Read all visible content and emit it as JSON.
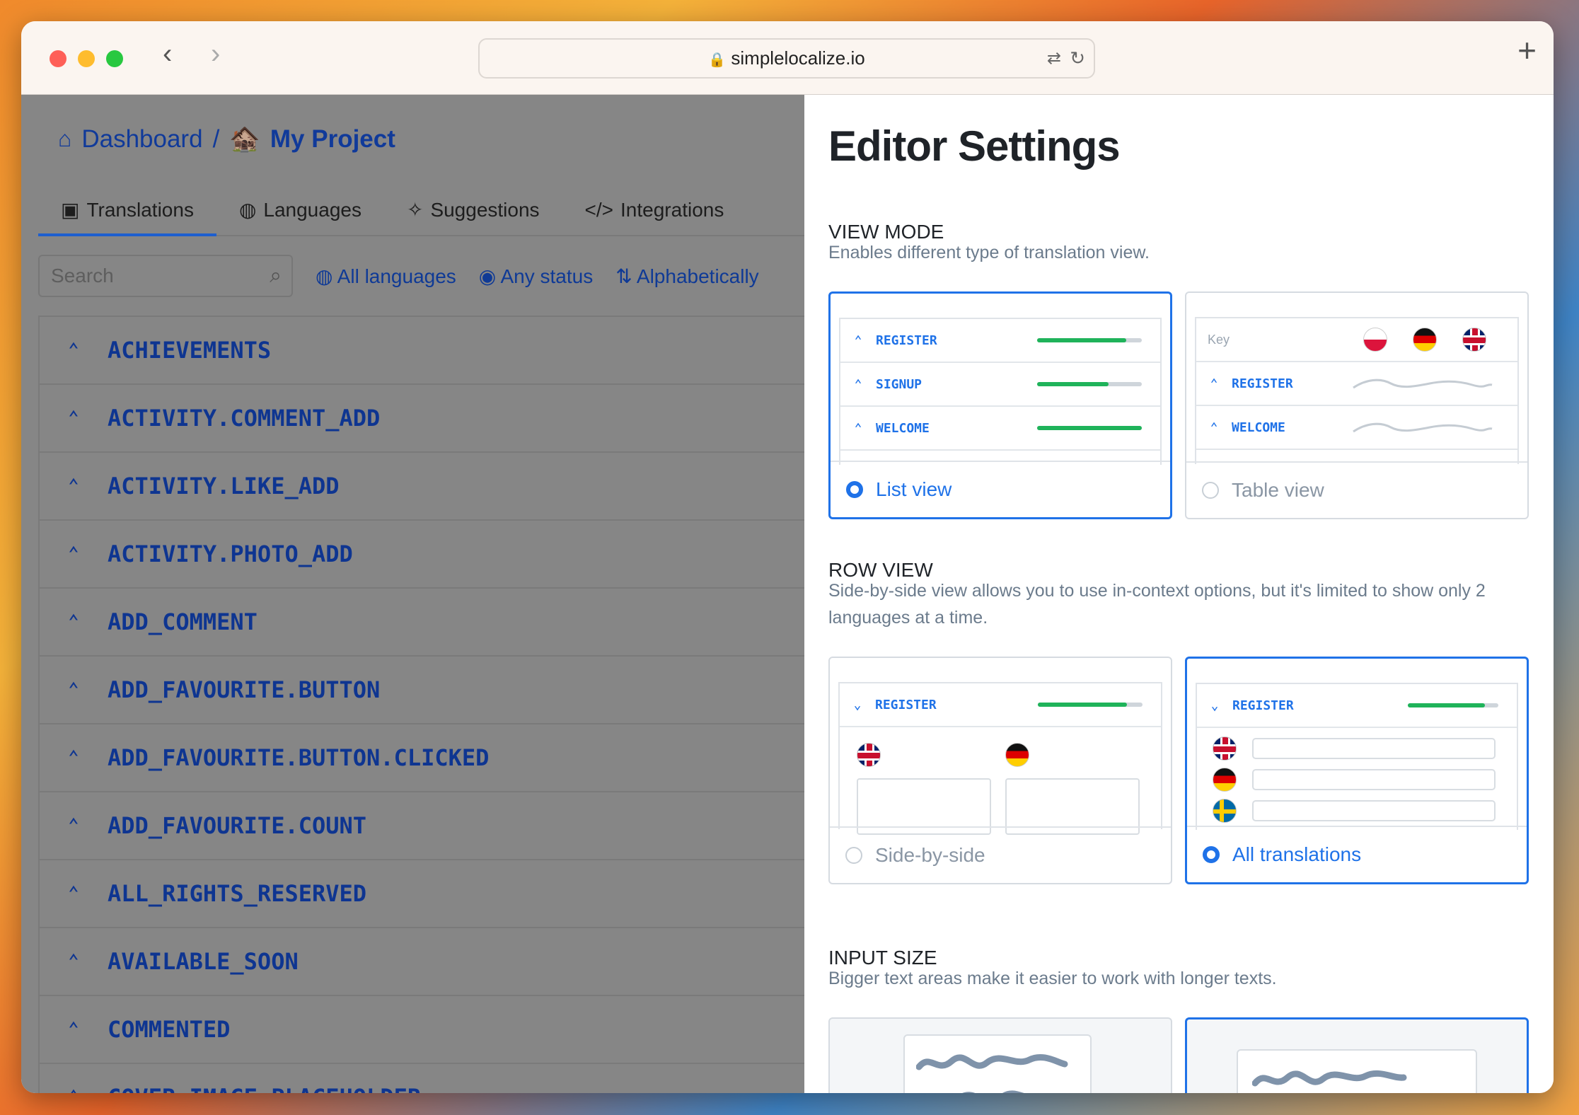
{
  "browser": {
    "url": "simplelocalize.io"
  },
  "breadcrumb": {
    "home": "Dashboard",
    "separator": "/",
    "project": "My Project",
    "project_emoji": "🏚️"
  },
  "tabs": [
    {
      "label": "Translations",
      "icon": "translations-icon"
    },
    {
      "label": "Languages",
      "icon": "globe-icon"
    },
    {
      "label": "Suggestions",
      "icon": "sparkle-icon"
    },
    {
      "label": "Integrations",
      "icon": "code-icon"
    }
  ],
  "filters": {
    "search_placeholder": "Search",
    "languages": "All languages",
    "status": "Any status",
    "sort": "Alphabetically"
  },
  "keys": [
    "ACHIEVEMENTS",
    "ACTIVITY.COMMENT_ADD",
    "ACTIVITY.LIKE_ADD",
    "ACTIVITY.PHOTO_ADD",
    "ADD_COMMENT",
    "ADD_FAVOURITE.BUTTON",
    "ADD_FAVOURITE.BUTTON.CLICKED",
    "ADD_FAVOURITE.COUNT",
    "ALL_RIGHTS_RESERVED",
    "AVAILABLE_SOON",
    "COMMENTED",
    "COVER_IMAGE_PLACEHOLDER"
  ],
  "settings": {
    "title": "Editor Settings",
    "view_mode": {
      "title": "VIEW MODE",
      "desc": "Enables different type of translation view.",
      "list_option": "List view",
      "table_option": "Table view",
      "list_preview": [
        {
          "key": "REGISTER",
          "progress": 0.85
        },
        {
          "key": "SIGNUP",
          "progress": 0.68
        },
        {
          "key": "WELCOME",
          "progress": 1.0
        }
      ],
      "table_header": "Key",
      "table_preview": [
        "REGISTER",
        "WELCOME"
      ],
      "selected": "list"
    },
    "row_view": {
      "title": "ROW VIEW",
      "desc": "Side-by-side view allows you to use in-context options, but it's limited to show only 2 languages at a time.",
      "side_option": "Side-by-side",
      "all_option": "All translations",
      "preview_key": "REGISTER",
      "progress": 0.85,
      "selected": "all"
    },
    "input_size": {
      "title": "INPUT SIZE",
      "desc": "Bigger text areas make it easier to work with longer texts."
    }
  },
  "colors": {
    "accent": "#1f72e8",
    "progress": "#1fb35a",
    "key_text": "#0e3591"
  }
}
